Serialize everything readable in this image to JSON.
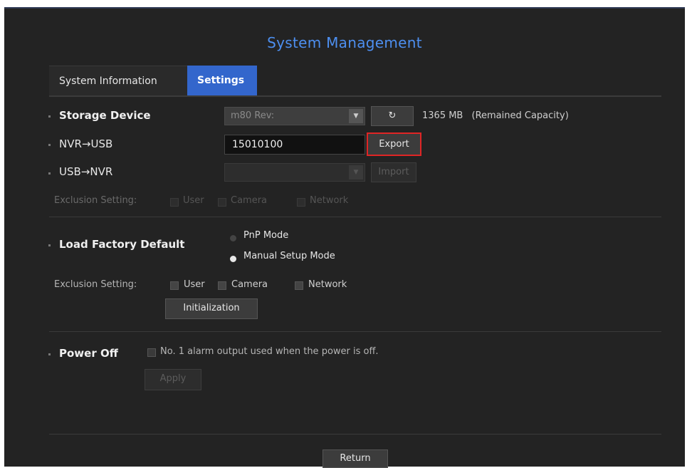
{
  "window": {
    "title": "System Management"
  },
  "tabs": [
    {
      "label": "System Information",
      "active": false
    },
    {
      "label": "Settings",
      "active": true
    }
  ],
  "storage": {
    "label": "Storage Device",
    "device_value": "m80 Rev:",
    "refresh_icon": "refresh-icon",
    "capacity": "1365 MB",
    "capacity_suffix": "(Remained Capacity)"
  },
  "nvr_usb": {
    "label": "NVR→USB",
    "filename": "15010100",
    "export_label": "Export"
  },
  "usb_nvr": {
    "label": "USB→NVR",
    "file_value": "",
    "import_label": "Import"
  },
  "exclusion_top": {
    "label": "Exclusion Setting:",
    "options": [
      "User",
      "Camera",
      "Network"
    ]
  },
  "factory": {
    "label": "Load Factory Default",
    "modes": [
      {
        "label": "PnP Mode",
        "selected": false
      },
      {
        "label": "Manual Setup Mode",
        "selected": true
      }
    ],
    "exclusion_label": "Exclusion Setting:",
    "exclusion_options": [
      "User",
      "Camera",
      "Network"
    ],
    "init_label": "Initialization"
  },
  "power": {
    "label": "Power Off",
    "alarm_text": "No. 1 alarm output used when the power is off.",
    "apply_label": "Apply"
  },
  "footer": {
    "return_label": "Return"
  },
  "colors": {
    "accent": "#3366cc",
    "title": "#4d8ff0",
    "highlight": "#e02525",
    "background": "#232323"
  }
}
